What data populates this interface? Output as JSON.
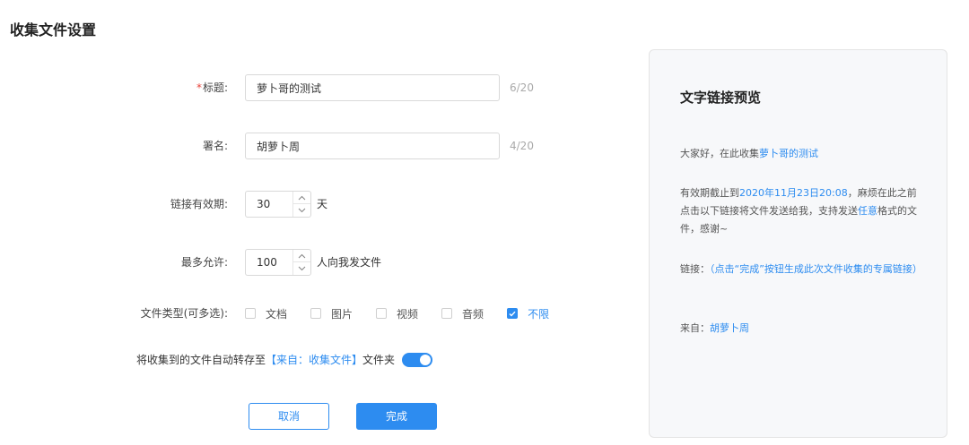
{
  "page_title": "收集文件设置",
  "form": {
    "title": {
      "required_mark": "*",
      "label": "标题:",
      "value": "萝卜哥的测试",
      "count": "6/20"
    },
    "signature": {
      "label": "署名:",
      "value": "胡萝卜周",
      "count": "4/20"
    },
    "validity": {
      "label": "链接有效期:",
      "value": "30",
      "unit": "天"
    },
    "max_allowed": {
      "label": "最多允许:",
      "value": "100",
      "unit": "人向我发文件"
    },
    "file_types": {
      "label": "文件类型(可多选):",
      "options": [
        {
          "label": "文档",
          "checked": false
        },
        {
          "label": "图片",
          "checked": false
        },
        {
          "label": "视频",
          "checked": false
        },
        {
          "label": "音频",
          "checked": false
        },
        {
          "label": "不限",
          "checked": true
        }
      ]
    },
    "auto_save": {
      "prefix": "将收集到的文件自动转存至",
      "folder": "【来自：收集文件】",
      "suffix": "文件夹",
      "enabled": true
    },
    "cancel_label": "取消",
    "done_label": "完成"
  },
  "preview": {
    "title": "文字链接预览",
    "greeting_prefix": "大家好，在此收集",
    "greeting_name": "萝卜哥的测试",
    "expiry_prefix": "有效期截止到",
    "expiry_date": "2020年11月23日20:08",
    "expiry_middle": "，麻烦在此之前点击以下链接将文件发送给我，支持发送",
    "expiry_type": "任意",
    "expiry_suffix": "格式的文件，感谢~",
    "link_label": "链接：",
    "link_text": "（点击“完成”按钮生成此次文件收集的专属链接）",
    "from_label": "来自：",
    "from_name": "胡萝卜周"
  },
  "colors": {
    "accent": "#2d8cf0",
    "required": "#e8433b"
  }
}
